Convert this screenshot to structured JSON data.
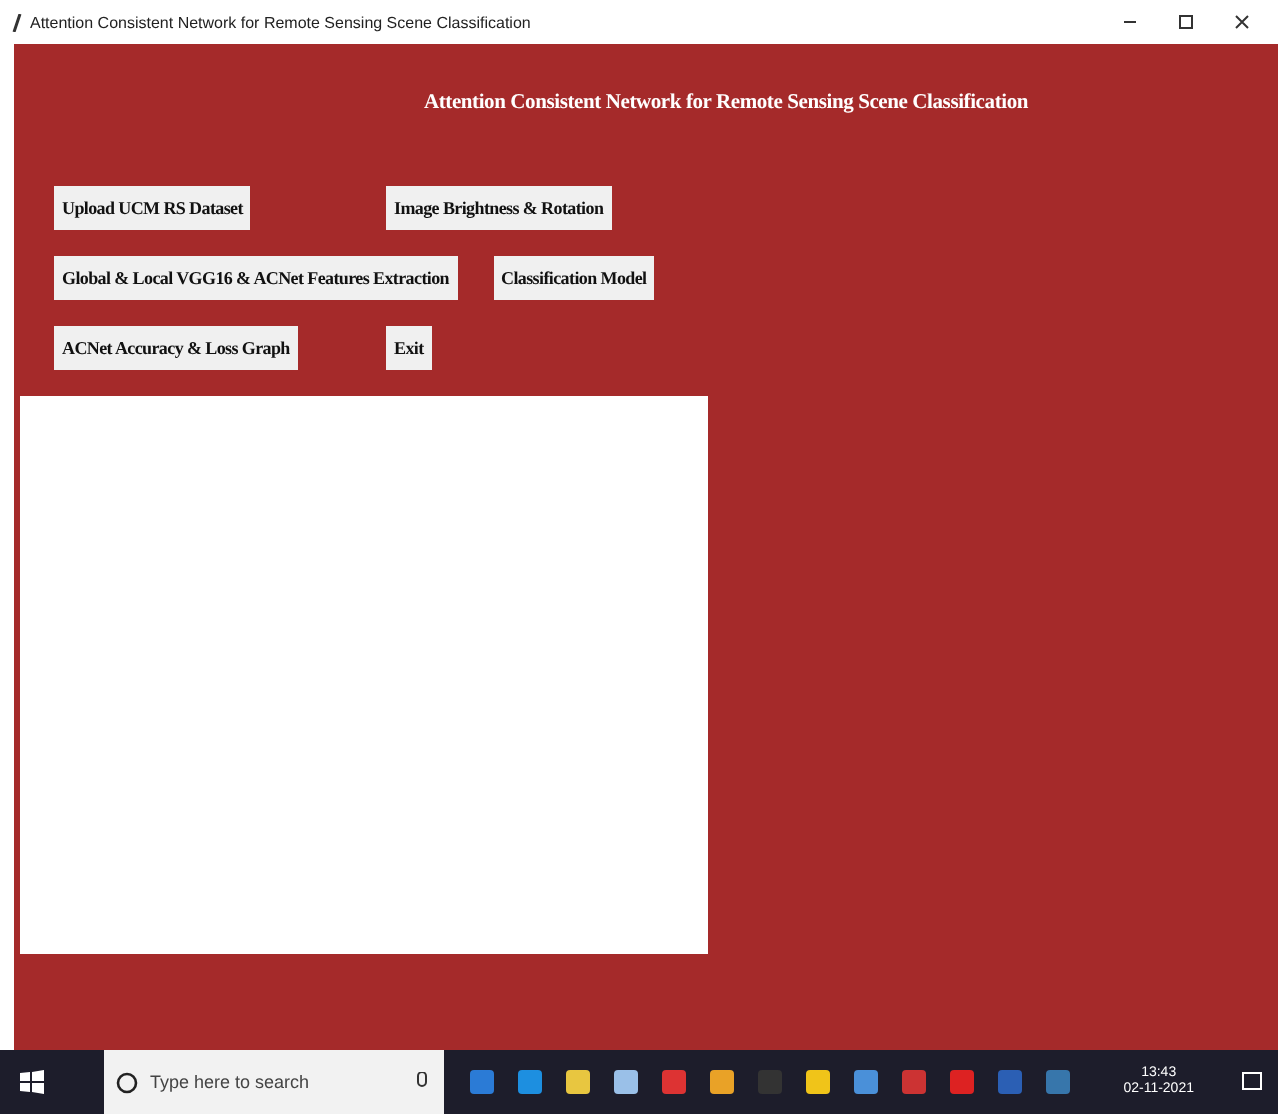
{
  "window": {
    "title": "Attention Consistent Network for Remote Sensing Scene Classification"
  },
  "heading": "Attention Consistent Network for Remote Sensing Scene Classification",
  "button_rows": [
    [
      "Upload UCM RS Dataset",
      "Image Brightness & Rotation"
    ],
    [
      "Global & Local VGG16 & ACNet Features Extraction",
      "Classification Model"
    ],
    [
      "ACNet Accuracy & Loss Graph",
      "Exit"
    ]
  ],
  "taskbar": {
    "search_placeholder": "Type here to search",
    "time": "13:43",
    "date": "02-11-2021"
  }
}
